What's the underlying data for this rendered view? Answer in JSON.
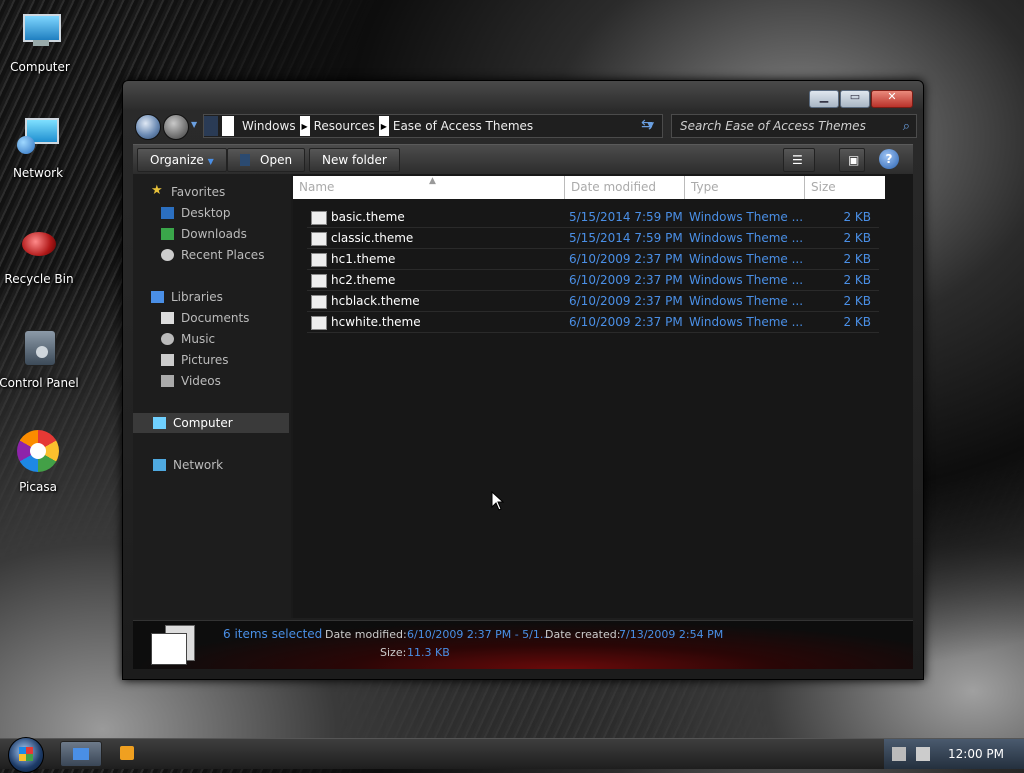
{
  "desktop": {
    "icons": [
      {
        "label": "Computer"
      },
      {
        "label": "Network"
      },
      {
        "label": "Recycle Bin"
      },
      {
        "label": "Control Panel"
      },
      {
        "label": "Picasa"
      }
    ]
  },
  "window": {
    "breadcrumbs": [
      "Windows",
      "Resources",
      "Ease of Access Themes"
    ],
    "search_placeholder": "Search Ease of Access Themes",
    "toolbar": {
      "organize": "Organize",
      "open": "Open",
      "new_folder": "New folder"
    },
    "nav": {
      "favorites": "Favorites",
      "desktop": "Desktop",
      "downloads": "Downloads",
      "recent": "Recent Places",
      "libraries": "Libraries",
      "documents": "Documents",
      "music": "Music",
      "pictures": "Pictures",
      "videos": "Videos",
      "computer": "Computer",
      "network": "Network"
    },
    "columns": {
      "name": "Name",
      "date": "Date modified",
      "type": "Type",
      "size": "Size"
    },
    "files": [
      {
        "name": "basic.theme",
        "date": "5/15/2014 7:59 PM",
        "type": "Windows Theme ...",
        "size": "2 KB"
      },
      {
        "name": "classic.theme",
        "date": "5/15/2014 7:59 PM",
        "type": "Windows Theme ...",
        "size": "2 KB"
      },
      {
        "name": "hc1.theme",
        "date": "6/10/2009 2:37 PM",
        "type": "Windows Theme ...",
        "size": "2 KB"
      },
      {
        "name": "hc2.theme",
        "date": "6/10/2009 2:37 PM",
        "type": "Windows Theme ...",
        "size": "2 KB"
      },
      {
        "name": "hcblack.theme",
        "date": "6/10/2009 2:37 PM",
        "type": "Windows Theme ...",
        "size": "2 KB"
      },
      {
        "name": "hcwhite.theme",
        "date": "6/10/2009 2:37 PM",
        "type": "Windows Theme ...",
        "size": "2 KB"
      }
    ],
    "details": {
      "selected": "6 items selected",
      "date_modified_label": "Date modified:",
      "date_modified_value": "6/10/2009 2:37 PM - 5/1...",
      "date_created_label": "Date created:",
      "date_created_value": "7/13/2009 2:54 PM",
      "size_label": "Size:",
      "size_value": "11.3 KB"
    }
  },
  "taskbar": {
    "clock": "12:00 PM"
  },
  "colors": {
    "accent_text": "#4a8fe6",
    "close_button": "#c0392b"
  }
}
